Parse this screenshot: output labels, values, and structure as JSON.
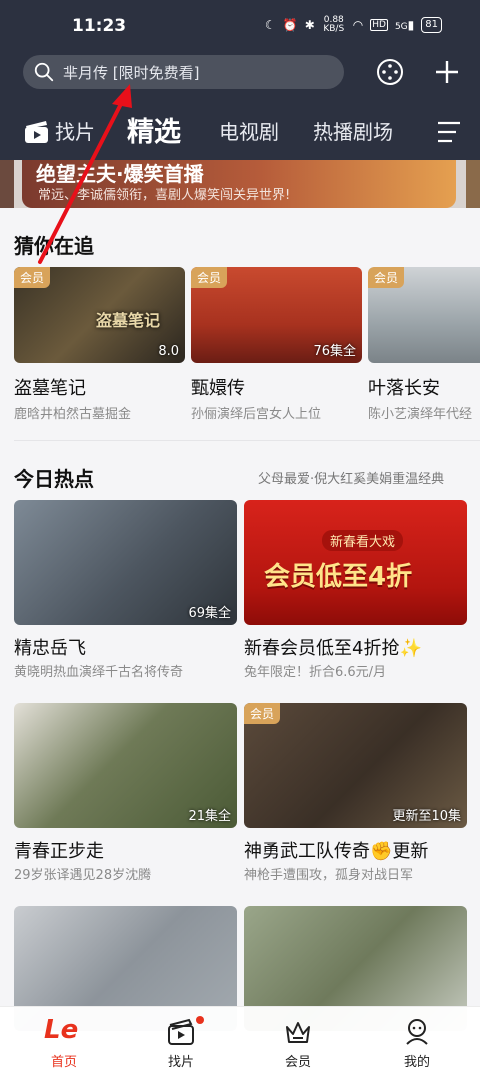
{
  "status_bar": {
    "time": "11:23",
    "speed": "0.88\nKB/S",
    "speed_text": "0.88 KB/S",
    "signal": "5G",
    "hd": "HD",
    "battery": "81"
  },
  "search": {
    "placeholder": "芈月传 [限时免费看]"
  },
  "tabs": [
    {
      "label": "找片"
    },
    {
      "label": "精选"
    },
    {
      "label": "电视剧"
    },
    {
      "label": "热播剧场"
    }
  ],
  "banner": {
    "title": "绝望主夫·爆笑首播",
    "subtitle": "常远、李诚儒领衔，喜剧人爆笑闯关异世界!"
  },
  "chasing": {
    "title": "猜你在追",
    "items": [
      {
        "badge": "会员",
        "corner": "8.0",
        "name": "盗墓笔记",
        "desc": "鹿晗井柏然古墓掘金",
        "poster_text": "盗墓笔记"
      },
      {
        "badge": "会员",
        "corner": "76集全",
        "name": "甄嬛传",
        "desc": "孙俪演绎后宫女人上位",
        "poster_text": ""
      },
      {
        "badge": "会员",
        "corner": "",
        "name": "叶落长安",
        "desc": "陈小艺演绎年代经",
        "poster_text": ""
      }
    ]
  },
  "hot": {
    "title": "今日热点",
    "subtitle": "父母最爱·倪大红奚美娟重温经典",
    "items": [
      {
        "badge": "",
        "corner": "69集全",
        "name": "精忠岳飞",
        "desc": "黄晓明热血演绎千古名将传奇"
      },
      {
        "badge": "",
        "corner": "",
        "name": "新春会员低至4折抢✨",
        "desc": "兔年限定！折合6.6元/月",
        "promo_top": "新春看大戏",
        "promo_main": "会员低至4折"
      },
      {
        "badge": "",
        "corner": "21集全",
        "name": "青春正步走",
        "desc": "29岁张译遇见28岁沈腾"
      },
      {
        "badge": "会员",
        "corner": "更新至10集",
        "name": "神勇武工队传奇✊更新",
        "desc": "神枪手遭围攻，孤身对战日军"
      }
    ]
  },
  "bottom_nav": [
    {
      "label": "首页",
      "logo": "Le"
    },
    {
      "label": "找片"
    },
    {
      "label": "会员"
    },
    {
      "label": "我的"
    }
  ],
  "colors": {
    "header_bg": "#2c3140",
    "accent": "#e8321d",
    "vip_badge": "#d8a35a"
  }
}
